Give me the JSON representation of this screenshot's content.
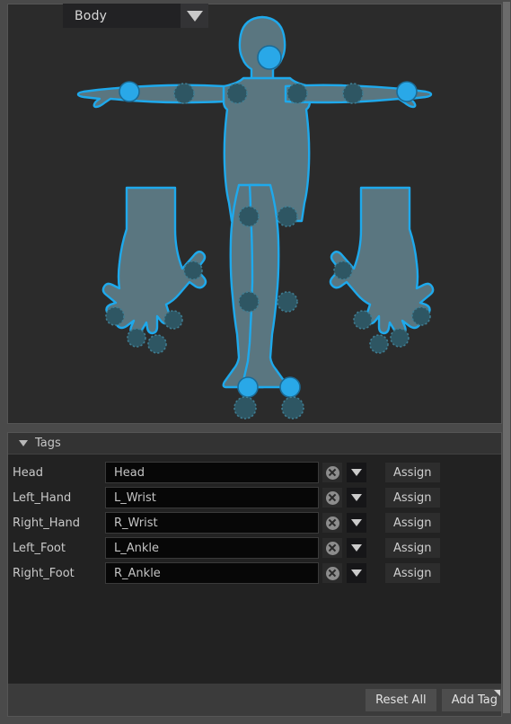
{
  "window": {
    "background_color": "#4a4a4a",
    "panel_border_color": "#555555"
  },
  "top_selector": {
    "label": "Body",
    "dropdown_icon": "chevron-down-icon",
    "options": [
      "Body"
    ]
  },
  "viewport": {
    "name": "body-rig-viewport",
    "background_color": "#2b2b2b",
    "figure": {
      "fill_color": "#5a7680",
      "outline_color": "#1ea9ec",
      "joint_selected_color": "#29a8e8",
      "joint_unselected_color": "#2e5663",
      "parts": [
        "body",
        "left-hand",
        "right-hand"
      ],
      "selected_joints": [
        "head",
        "left-wrist",
        "right-wrist",
        "left-ankle",
        "right-ankle"
      ],
      "unselected_joints": [
        "left-shoulder",
        "right-shoulder",
        "left-elbow",
        "right-elbow",
        "left-hip",
        "right-hip",
        "left-knee",
        "right-knee",
        "left-foot",
        "right-foot",
        "hand-finger-joints"
      ]
    }
  },
  "tags_panel": {
    "header": {
      "title": "Tags",
      "collapse_icon": "triangle-down-icon",
      "expanded": true
    },
    "column_action_label": "Assign",
    "clear_icon": "clear-circle-x-icon",
    "dropdown_icon": "chevron-down-icon",
    "rows": [
      {
        "label": "Head",
        "value": "Head",
        "action": "Assign"
      },
      {
        "label": "Left_Hand",
        "value": "L_Wrist",
        "action": "Assign"
      },
      {
        "label": "Right_Hand",
        "value": "R_Wrist",
        "action": "Assign"
      },
      {
        "label": "Left_Foot",
        "value": "L_Ankle",
        "action": "Assign"
      },
      {
        "label": "Right_Foot",
        "value": "R_Ankle",
        "action": "Assign"
      }
    ]
  },
  "bottom_bar": {
    "reset_label": "Reset All",
    "add_tag_label": "Add Tag",
    "add_tag_menu_icon": "corner-triangle-icon"
  },
  "scrollbar": {
    "name": "vertical-scrollbar",
    "orientation": "vertical"
  }
}
